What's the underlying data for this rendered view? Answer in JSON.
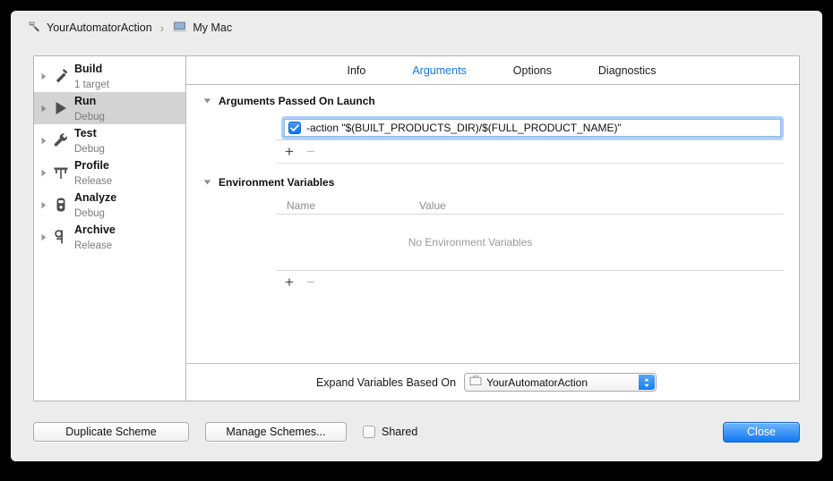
{
  "window": {
    "breadcrumb": {
      "scheme_icon": "automator-scheme-icon",
      "scheme_name": "YourAutomatorAction",
      "separator": "›",
      "destination_icon": "laptop-icon",
      "destination_name": "My Mac"
    }
  },
  "sidebar": {
    "items": [
      {
        "name": "Build",
        "sub": "1 target",
        "icon": "hammer-icon",
        "selected": false
      },
      {
        "name": "Run",
        "sub": "Debug",
        "icon": "play-icon",
        "selected": true
      },
      {
        "name": "Test",
        "sub": "Debug",
        "icon": "wrench-icon",
        "selected": false
      },
      {
        "name": "Profile",
        "sub": "Release",
        "icon": "gauge-icon",
        "selected": false
      },
      {
        "name": "Analyze",
        "sub": "Debug",
        "icon": "analyze-icon",
        "selected": false
      },
      {
        "name": "Archive",
        "sub": "Release",
        "icon": "archive-icon",
        "selected": false
      }
    ]
  },
  "tabs": [
    {
      "label": "Info",
      "active": false
    },
    {
      "label": "Arguments",
      "active": true
    },
    {
      "label": "Options",
      "active": false
    },
    {
      "label": "Diagnostics",
      "active": false
    }
  ],
  "arguments_section": {
    "title": "Arguments Passed On Launch",
    "rows": [
      {
        "checked": true,
        "value": "-action \"$(BUILT_PRODUCTS_DIR)/$(FULL_PRODUCT_NAME)\"",
        "focused": true
      }
    ],
    "add_label": "+",
    "remove_label": "−"
  },
  "environment_section": {
    "title": "Environment Variables",
    "columns": {
      "name": "Name",
      "value": "Value"
    },
    "empty_message": "No Environment Variables",
    "rows": [],
    "add_label": "+",
    "remove_label": "−"
  },
  "expand_variables": {
    "label": "Expand Variables Based On",
    "selected": "YourAutomatorAction",
    "target_icon": "target-folder-icon"
  },
  "footer": {
    "duplicate_label": "Duplicate Scheme",
    "manage_label": "Manage Schemes...",
    "shared_label": "Shared",
    "shared_checked": false,
    "close_label": "Close"
  },
  "colors": {
    "accent": "#1a74d8",
    "default_button": "#1277f2",
    "selection": "#d3d3d3",
    "focus_ring": "#a8d0fb"
  }
}
